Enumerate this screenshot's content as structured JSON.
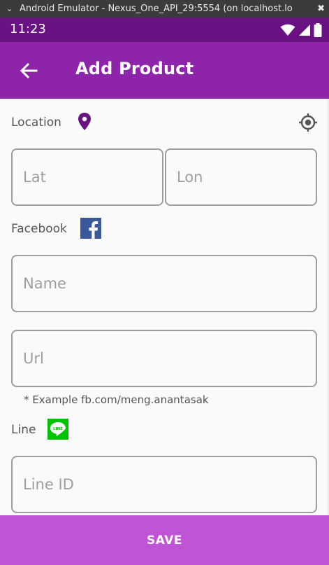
{
  "window": {
    "title": "Android Emulator - Nexus_One_API_29:5554 (on localhost.lo"
  },
  "status_bar": {
    "time": "11:23",
    "icons": [
      "wifi-icon",
      "signal-icon",
      "battery-icon"
    ]
  },
  "app_bar": {
    "title": "Add Product",
    "back_icon": "arrow-back-icon",
    "color": "#8e24aa"
  },
  "location": {
    "label": "Location",
    "pin_icon": "location-pin-icon",
    "gps_icon": "my-location-icon",
    "lat_placeholder": "Lat",
    "lon_placeholder": "Lon"
  },
  "facebook": {
    "label": "Facebook",
    "icon": "facebook-icon",
    "name_placeholder": "Name",
    "url_placeholder": "Url",
    "hint": "* Example fb.com/meng.anantasak"
  },
  "line": {
    "label": "Line",
    "icon": "line-icon",
    "id_placeholder": "Line ID"
  },
  "save": {
    "label": "SAVE",
    "color": "#c054d6"
  }
}
